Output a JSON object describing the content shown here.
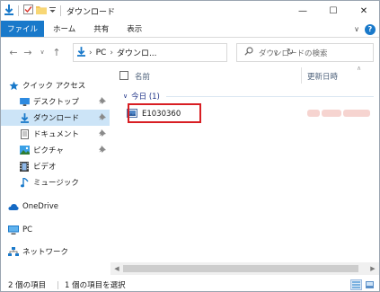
{
  "window": {
    "title": "ダウンロード",
    "controls": {
      "minimize": "—",
      "maximize": "☐",
      "close": "✕"
    }
  },
  "ribbon": {
    "tabs": [
      {
        "label": "ファイル"
      },
      {
        "label": "ホーム"
      },
      {
        "label": "共有"
      },
      {
        "label": "表示"
      }
    ],
    "collapse": "∨",
    "help": "?"
  },
  "nav": {
    "back": "←",
    "forward": "→",
    "recent": "∨",
    "up": "↑",
    "path": {
      "root": "PC",
      "sep": "›",
      "folder": "ダウンロ..."
    },
    "dropdown": "∨",
    "refresh": "↻",
    "search_placeholder": "ダウンロードの検索"
  },
  "sidebar": {
    "items": [
      {
        "label": "クイック アクセス"
      },
      {
        "label": "デスクトップ"
      },
      {
        "label": "ダウンロード"
      },
      {
        "label": "ドキュメント"
      },
      {
        "label": "ピクチャ"
      },
      {
        "label": "ビデオ"
      },
      {
        "label": "ミュージック"
      },
      {
        "label": "OneDrive"
      },
      {
        "label": "PC"
      },
      {
        "label": "ネットワーク"
      }
    ],
    "pin": "📌"
  },
  "columns": {
    "name": "名前",
    "date": "更新日時",
    "sort": "∧"
  },
  "group": {
    "label": "今日 (1)",
    "toggle": "∨"
  },
  "files": [
    {
      "name": "E1030360"
    }
  ],
  "scroll": {
    "left": "◀",
    "right": "▶"
  },
  "status": {
    "count": "2 個の項目",
    "selected": "1 個の項目を選択"
  },
  "colors": {
    "accent": "#1979ca",
    "highlight": "#d81e23",
    "selected": "#cce4f7"
  }
}
